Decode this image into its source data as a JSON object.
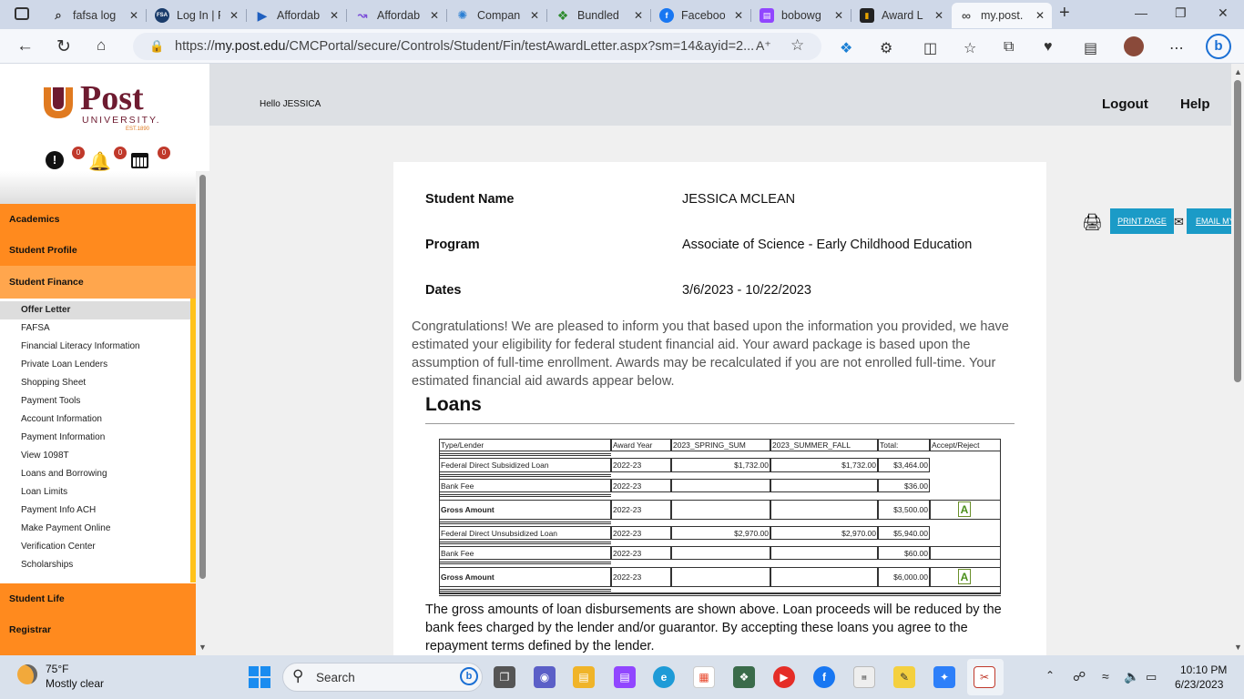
{
  "browser": {
    "tabs": [
      {
        "label": "fafsa log",
        "icon": "search-icon"
      },
      {
        "label": "Log In | F",
        "icon": "fsa-icon"
      },
      {
        "label": "Affordab",
        "icon": "play-icon"
      },
      {
        "label": "Affordab",
        "icon": "canva-icon"
      },
      {
        "label": "Compan",
        "icon": "company-icon"
      },
      {
        "label": "Bundled",
        "icon": "bundled-icon"
      },
      {
        "label": "Faceboo",
        "icon": "facebook-icon"
      },
      {
        "label": "bobowg",
        "icon": "twitch-icon"
      },
      {
        "label": "Award L",
        "icon": "award-icon"
      },
      {
        "label": "my.post.",
        "icon": "post-icon"
      }
    ],
    "url_prefix": "https://",
    "url_host": "my.post.edu",
    "url_path": "/CMCPortal/secure/Controls/Student/Fin/testAwardLetter.aspx?sm=14&ayid=2..."
  },
  "sidebar": {
    "logo_word": "Post",
    "logo_sub": "UNIVERSITY.",
    "logo_est": "EST.1890",
    "badges": [
      "0",
      "0",
      "0"
    ],
    "main_items": [
      "Academics",
      "Student Profile",
      "Student Finance",
      "Student Life",
      "Registrar"
    ],
    "sub_items": [
      "Offer Letter",
      "FAFSA",
      "Financial Literacy Information",
      "Private Loan Lenders",
      "Shopping Sheet",
      "Payment Tools",
      "Account Information",
      "Payment Information",
      "View 1098T",
      "Loans and Borrowing",
      "Loan Limits",
      "Payment Info ACH",
      "Make Payment Online",
      "Verification Center",
      "Scholarships"
    ]
  },
  "header": {
    "greeting": "Hello JESSICA",
    "logout": "Logout",
    "help": "Help"
  },
  "actions": {
    "print": "PRINT PAGE",
    "email": "EMAIL MY"
  },
  "student": {
    "name_label": "Student Name",
    "name": "JESSICA MCLEAN",
    "program_label": "Program",
    "program": "Associate of Science - Early Childhood Education",
    "dates_label": "Dates",
    "dates": "3/6/2023 - 10/22/2023"
  },
  "intro": "Congratulations! We are pleased to inform you that based upon the information you provided, we have estimated your eligibility for federal student financial aid. Your award package is based upon the assumption of full-time enrollment. Awards may be recalculated if you are not enrolled full-time. Your estimated financial aid awards appear below.",
  "loans": {
    "title": "Loans",
    "headers": [
      "Type/Lender",
      "Award Year",
      "2023_SPRING_SUM",
      "2023_SUMMER_FALL",
      "Total:",
      "Accept/Reject"
    ],
    "rows": [
      [
        "Federal Direct Subsidized Loan",
        "2022-23",
        "$1,732.00",
        "$1,732.00",
        "$3,464.00"
      ],
      [
        "Bank Fee",
        "2022-23",
        "",
        "",
        "$36.00"
      ],
      [
        "Gross Amount",
        "2022-23",
        "",
        "",
        "$3,500.00"
      ],
      [
        "Federal Direct Unsubsidized Loan",
        "2022-23",
        "$2,970.00",
        "$2,970.00",
        "$5,940.00"
      ],
      [
        "Bank Fee",
        "2022-23",
        "",
        "",
        "$60.00"
      ],
      [
        "Gross Amount",
        "2022-23",
        "",
        "",
        "$6,000.00"
      ]
    ],
    "footer": "The gross amounts of loan disbursements are shown above. Loan proceeds will be reduced by the bank fees charged by the lender and/or guarantor. By accepting these loans you agree to the repayment terms defined by the lender."
  },
  "taskbar": {
    "temp": "75°F",
    "weather": "Mostly clear",
    "search": "Search",
    "time": "10:10 PM",
    "date": "6/23/2023"
  }
}
